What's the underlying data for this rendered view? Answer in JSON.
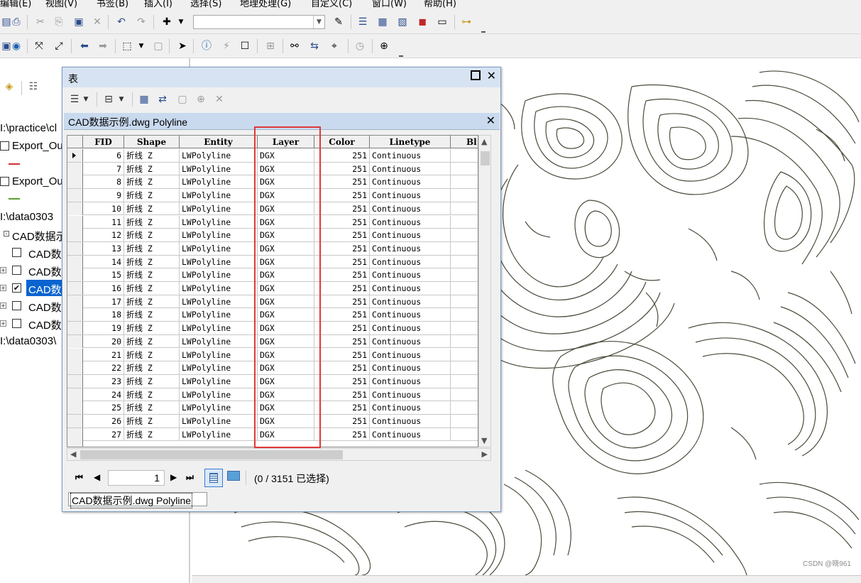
{
  "menu": {
    "items": [
      "编辑(E)",
      "视图(V)",
      "书签(B)",
      "插入(I)",
      "选择(S)",
      "地理处理(G)",
      "自定义(C)",
      "窗口(W)",
      "帮助(H)"
    ]
  },
  "toc": {
    "lines": [
      {
        "text": "I:\\practice\\cl"
      },
      {
        "text": "Export_Ou"
      },
      {
        "text": "Export_Ou"
      },
      {
        "text": "I:\\data0303"
      },
      {
        "text": "CAD数据示"
      },
      {
        "text": "CAD数"
      },
      {
        "text": "CAD数"
      },
      {
        "text": "CAD数"
      },
      {
        "text": "CAD数"
      },
      {
        "text": "CAD数"
      },
      {
        "text": "I:\\data0303\\"
      }
    ],
    "colors": {
      "selected": "#0a64d0",
      "export_1_line": "#d03030",
      "export_2_line": "#58a030"
    }
  },
  "table_window": {
    "title": "表",
    "tab_title": "CAD数据示例.dwg Polyline",
    "columns": [
      "FID",
      "Shape",
      "Entity",
      "Layer",
      "Color",
      "Linetype",
      "Bl"
    ],
    "rows": [
      {
        "fid": "6",
        "shape": "折线 Z",
        "entity": "LWPolyline",
        "layer": "DGX",
        "color": "251",
        "linetype": "Continuous"
      },
      {
        "fid": "7",
        "shape": "折线 Z",
        "entity": "LWPolyline",
        "layer": "DGX",
        "color": "251",
        "linetype": "Continuous"
      },
      {
        "fid": "8",
        "shape": "折线 Z",
        "entity": "LWPolyline",
        "layer": "DGX",
        "color": "251",
        "linetype": "Continuous"
      },
      {
        "fid": "9",
        "shape": "折线 Z",
        "entity": "LWPolyline",
        "layer": "DGX",
        "color": "251",
        "linetype": "Continuous"
      },
      {
        "fid": "10",
        "shape": "折线 Z",
        "entity": "LWPolyline",
        "layer": "DGX",
        "color": "251",
        "linetype": "Continuous"
      },
      {
        "fid": "11",
        "shape": "折线 Z",
        "entity": "LWPolyline",
        "layer": "DGX",
        "color": "251",
        "linetype": "Continuous"
      },
      {
        "fid": "12",
        "shape": "折线 Z",
        "entity": "LWPolyline",
        "layer": "DGX",
        "color": "251",
        "linetype": "Continuous"
      },
      {
        "fid": "13",
        "shape": "折线 Z",
        "entity": "LWPolyline",
        "layer": "DGX",
        "color": "251",
        "linetype": "Continuous"
      },
      {
        "fid": "14",
        "shape": "折线 Z",
        "entity": "LWPolyline",
        "layer": "DGX",
        "color": "251",
        "linetype": "Continuous"
      },
      {
        "fid": "15",
        "shape": "折线 Z",
        "entity": "LWPolyline",
        "layer": "DGX",
        "color": "251",
        "linetype": "Continuous"
      },
      {
        "fid": "16",
        "shape": "折线 Z",
        "entity": "LWPolyline",
        "layer": "DGX",
        "color": "251",
        "linetype": "Continuous"
      },
      {
        "fid": "17",
        "shape": "折线 Z",
        "entity": "LWPolyline",
        "layer": "DGX",
        "color": "251",
        "linetype": "Continuous"
      },
      {
        "fid": "18",
        "shape": "折线 Z",
        "entity": "LWPolyline",
        "layer": "DGX",
        "color": "251",
        "linetype": "Continuous"
      },
      {
        "fid": "19",
        "shape": "折线 Z",
        "entity": "LWPolyline",
        "layer": "DGX",
        "color": "251",
        "linetype": "Continuous"
      },
      {
        "fid": "20",
        "shape": "折线 Z",
        "entity": "LWPolyline",
        "layer": "DGX",
        "color": "251",
        "linetype": "Continuous"
      },
      {
        "fid": "21",
        "shape": "折线 Z",
        "entity": "LWPolyline",
        "layer": "DGX",
        "color": "251",
        "linetype": "Continuous"
      },
      {
        "fid": "22",
        "shape": "折线 Z",
        "entity": "LWPolyline",
        "layer": "DGX",
        "color": "251",
        "linetype": "Continuous"
      },
      {
        "fid": "23",
        "shape": "折线 Z",
        "entity": "LWPolyline",
        "layer": "DGX",
        "color": "251",
        "linetype": "Continuous"
      },
      {
        "fid": "24",
        "shape": "折线 Z",
        "entity": "LWPolyline",
        "layer": "DGX",
        "color": "251",
        "linetype": "Continuous"
      },
      {
        "fid": "25",
        "shape": "折线 Z",
        "entity": "LWPolyline",
        "layer": "DGX",
        "color": "251",
        "linetype": "Continuous"
      },
      {
        "fid": "26",
        "shape": "折线 Z",
        "entity": "LWPolyline",
        "layer": "DGX",
        "color": "251",
        "linetype": "Continuous"
      },
      {
        "fid": "27",
        "shape": "折线 Z",
        "entity": "LWPolyline",
        "layer": "DGX",
        "color": "251",
        "linetype": "Continuous"
      }
    ],
    "nav": {
      "record": "1",
      "selection_status": "(0 / 3151 已选择)"
    },
    "bottom_tab": "CAD数据示例.dwg Polyline",
    "highlight_color": "#e03838"
  },
  "map": {
    "line_color": "#4a4a3a"
  },
  "watermark": "CSDN @晓961"
}
